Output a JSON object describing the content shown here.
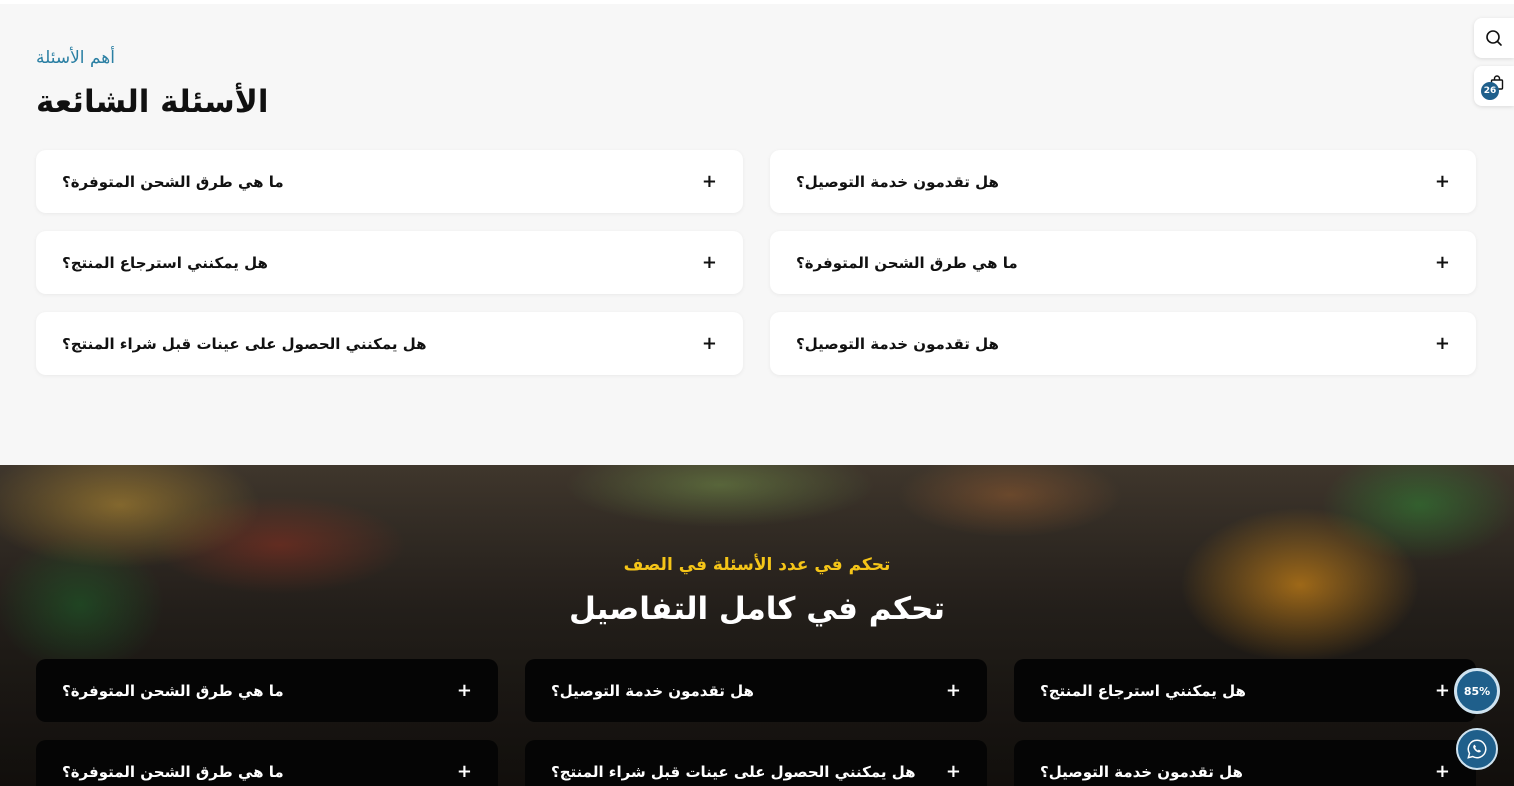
{
  "faq_section": {
    "subtitle": "أهم الأسئلة",
    "title": "الأسئلة الشائعة",
    "items": [
      {
        "question": "ما هي طرق الشحن المتوفرة؟",
        "icon": "+"
      },
      {
        "question": "هل تقدمون خدمة التوصيل؟",
        "icon": "+"
      },
      {
        "question": "هل يمكنني استرجاع المنتج؟",
        "icon": "+"
      },
      {
        "question": "ما هي طرق الشحن المتوفرة؟",
        "icon": "+"
      },
      {
        "question": "هل يمكنني الحصول على عينات قبل شراء المنتج؟",
        "icon": "+"
      },
      {
        "question": "هل تقدمون خدمة التوصيل؟",
        "icon": "+"
      }
    ]
  },
  "hero_section": {
    "subtitle": "تحكم في عدد الأسئلة في الصف",
    "title": "تحكم في كامل التفاصيل",
    "items": [
      {
        "question": "ما هي طرق الشحن المتوفرة؟",
        "icon": "+"
      },
      {
        "question": "هل تقدمون خدمة التوصيل؟",
        "icon": "+"
      },
      {
        "question": "هل يمكنني استرجاع المنتج؟",
        "icon": "+"
      },
      {
        "question": "ما هي طرق الشحن المتوفرة؟",
        "icon": "+"
      },
      {
        "question": "هل يمكنني الحصول على عينات قبل شراء المنتج؟",
        "icon": "+"
      },
      {
        "question": "هل تقدمون خدمة التوصيل؟",
        "icon": "+"
      }
    ]
  },
  "floating": {
    "search_icon": "search-icon",
    "cart_icon": "shopping-bag-icon",
    "cart_count": "26",
    "scroll_progress": "85%",
    "whatsapp_icon": "whatsapp-icon"
  },
  "colors": {
    "accent": "#2a7fa3",
    "hero_subtitle": "#f5c518",
    "badge": "#1f5f8b"
  }
}
